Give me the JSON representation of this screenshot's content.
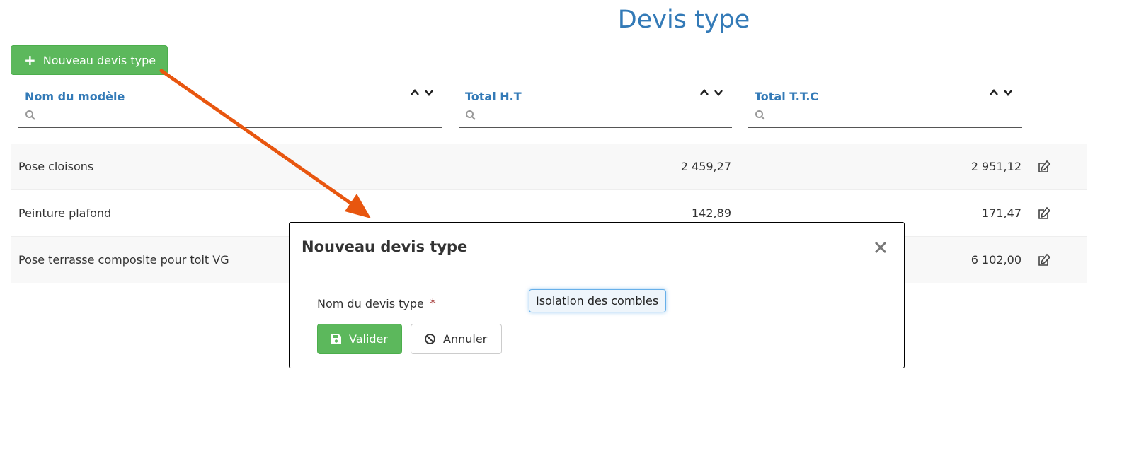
{
  "page": {
    "title": "Devis type"
  },
  "toolbar": {
    "new_label": "Nouveau devis type",
    "new_icon": "plus-icon"
  },
  "table": {
    "columns": [
      {
        "label": "Nom du modèle",
        "search_placeholder": ""
      },
      {
        "label": "Total H.T",
        "search_placeholder": ""
      },
      {
        "label": "Total T.T.C",
        "search_placeholder": ""
      }
    ],
    "rows": [
      {
        "name": "Pose cloisons",
        "ht": "2 459,27",
        "ttc": "2 951,12"
      },
      {
        "name": "Peinture plafond",
        "ht": "142,89",
        "ttc": "171,47"
      },
      {
        "name": "Pose terrasse composite pour toit VG",
        "ht": "",
        "ttc": "6 102,00"
      }
    ]
  },
  "modal": {
    "title": "Nouveau devis type",
    "field_label": "Nom du devis type",
    "required_mark": "*",
    "field_value": "Isolation des combles",
    "save_label": "Valider",
    "cancel_label": "Annuler"
  },
  "colors": {
    "accent": "#337ab7",
    "success": "#5cb85c",
    "annotation_arrow": "#e8560f"
  }
}
